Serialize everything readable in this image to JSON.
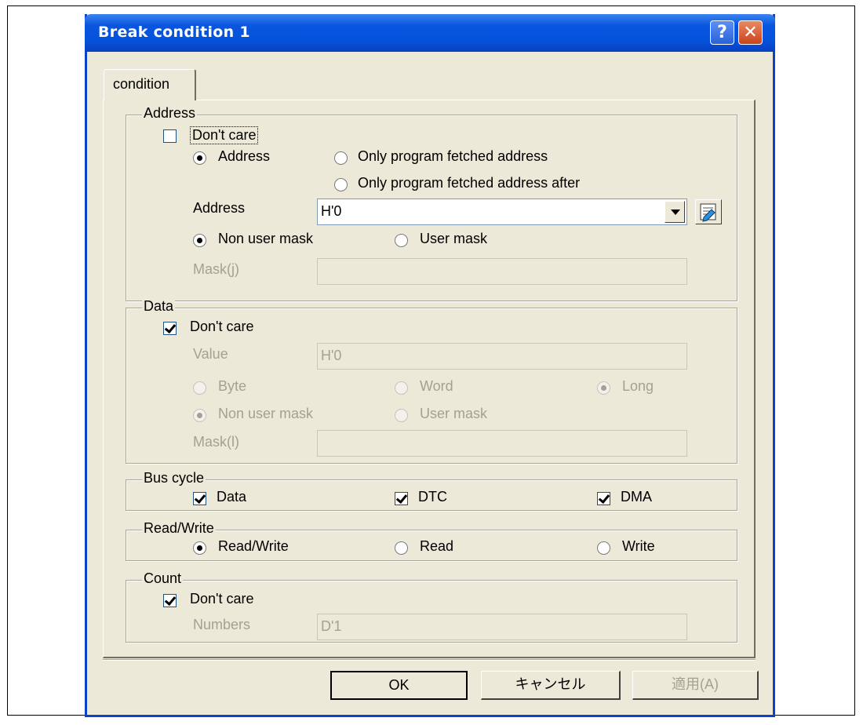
{
  "dialog": {
    "title": "Break condition 1",
    "help_glyph": "?",
    "close_glyph": "✕",
    "tab_label": "condition"
  },
  "address": {
    "legend": "Address",
    "dont_care_label": "Don't care",
    "dont_care_checked": false,
    "radio_address": "Address",
    "radio_fetched": "Only program fetched address",
    "radio_fetched_after": "Only program fetched address after",
    "address_label": "Address",
    "address_value": "H'0",
    "non_user_mask": "Non user mask",
    "user_mask": "User mask",
    "mask_label": "Mask(j)",
    "mask_value": ""
  },
  "data": {
    "legend": "Data",
    "dont_care_label": "Don't care",
    "dont_care_checked": true,
    "value_label": "Value",
    "value": "H'0",
    "byte": "Byte",
    "word": "Word",
    "long": "Long",
    "non_user_mask": "Non user mask",
    "user_mask": "User mask",
    "mask_label": "Mask(l)",
    "mask_value": ""
  },
  "bus_cycle": {
    "legend": "Bus cycle",
    "data": "Data",
    "dtc": "DTC",
    "dma": "DMA"
  },
  "read_write": {
    "legend": "Read/Write",
    "read_write": "Read/Write",
    "read": "Read",
    "write": "Write"
  },
  "count": {
    "legend": "Count",
    "dont_care_label": "Don't care",
    "numbers_label": "Numbers",
    "numbers_value": "D'1"
  },
  "buttons": {
    "ok": "OK",
    "cancel": "キャンセル",
    "apply": "適用(A)"
  },
  "colors": {
    "title_blue": "#0453dc",
    "dialog_bg": "#ece9d8",
    "disabled_text": "#a3a193"
  }
}
